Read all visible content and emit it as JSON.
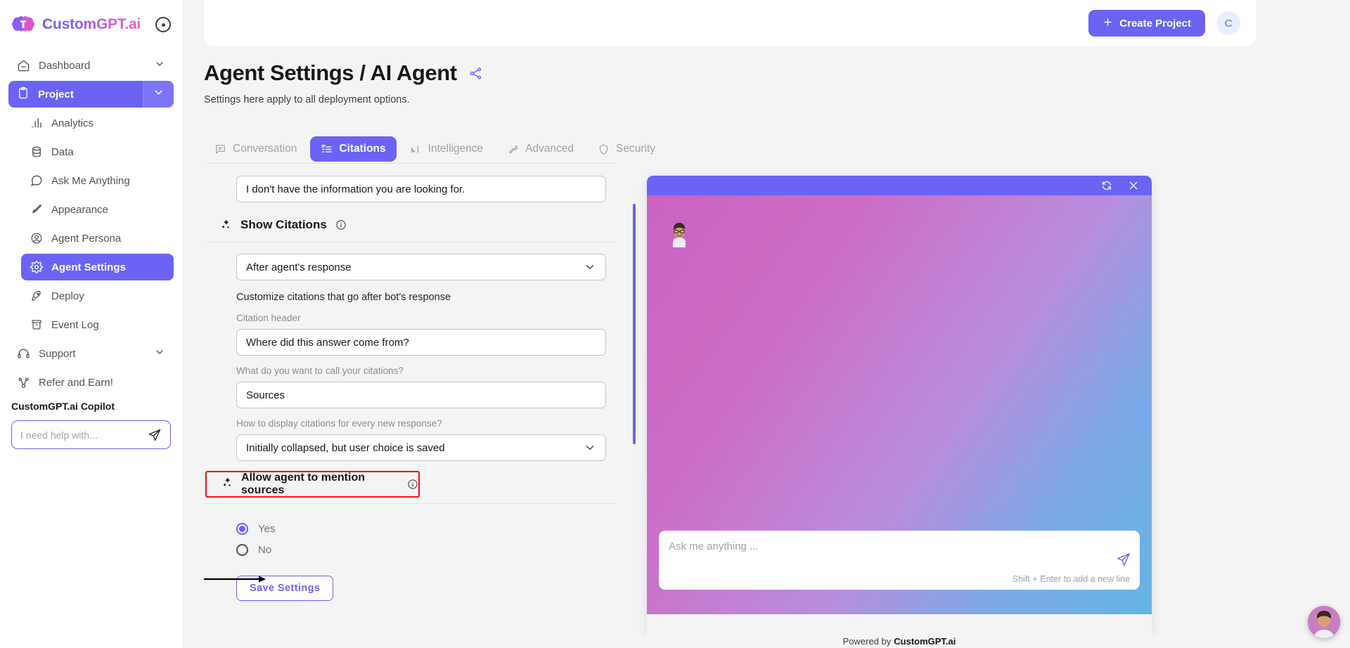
{
  "brand": {
    "name": "CustomGPT.ai",
    "collapse_icon": "collapse-circle-icon"
  },
  "sidebar": {
    "items": [
      {
        "label": "Dashboard",
        "icon": "home-icon",
        "chevron": true,
        "level": "top",
        "state": "default"
      },
      {
        "label": "Project",
        "icon": "clipboard-icon",
        "chevron": true,
        "level": "top",
        "state": "active"
      },
      {
        "label": "Analytics",
        "icon": "bar-chart-icon",
        "level": "sub",
        "state": "default"
      },
      {
        "label": "Data",
        "icon": "database-icon",
        "level": "sub",
        "state": "default"
      },
      {
        "label": "Ask Me Anything",
        "icon": "chat-bubble-icon",
        "level": "sub",
        "state": "default"
      },
      {
        "label": "Appearance",
        "icon": "brush-icon",
        "level": "sub",
        "state": "default"
      },
      {
        "label": "Agent Persona",
        "icon": "user-circle-icon",
        "level": "sub",
        "state": "default"
      },
      {
        "label": "Agent Settings",
        "icon": "gear-icon",
        "level": "sub",
        "state": "active"
      },
      {
        "label": "Deploy",
        "icon": "rocket-icon",
        "level": "sub",
        "state": "default"
      },
      {
        "label": "Event Log",
        "icon": "archive-icon",
        "level": "sub",
        "state": "default"
      },
      {
        "label": "Support",
        "icon": "headset-icon",
        "chevron": true,
        "level": "top",
        "state": "default"
      },
      {
        "label": "Refer and Earn!",
        "icon": "share-nodes-icon",
        "level": "top",
        "state": "default"
      }
    ],
    "copilot": {
      "title": "CustomGPT.ai Copilot",
      "placeholder": "I need help with...",
      "value": "",
      "send_icon": "paper-plane-icon"
    }
  },
  "topbar": {
    "create_label": "Create Project",
    "plus_icon": "plus-icon",
    "avatar_initial": "C"
  },
  "page": {
    "title": "Agent Settings / AI Agent",
    "share_icon": "share-icon",
    "subtitle": "Settings here apply to all deployment options."
  },
  "tabs": [
    {
      "label": "Conversation",
      "icon": "message-square-icon",
      "active": false
    },
    {
      "label": "Citations",
      "icon": "quote-list-icon",
      "active": true
    },
    {
      "label": "Intelligence",
      "icon": "ai-icon",
      "active": false
    },
    {
      "label": "Advanced",
      "icon": "wrench-icon",
      "active": false
    },
    {
      "label": "Security",
      "icon": "shield-icon",
      "active": false
    }
  ],
  "form": {
    "fallback_value": "I don't have the information you are looking for.",
    "show_citations": {
      "heading": "Show Citations",
      "heading_icon": "sparkle-icon",
      "info_icon": "info-icon",
      "select_value": "After agent's response",
      "chevron_icon": "chevron-down-icon",
      "helper": "Customize citations that go after bot's response"
    },
    "citation_header": {
      "label": "Citation header",
      "value": "Where did this answer come from?"
    },
    "citation_name": {
      "label": "What do you want to call your citations?",
      "value": "Sources"
    },
    "citation_display": {
      "label": "How to display citations for every new response?",
      "value": "Initially collapsed, but user choice is saved"
    },
    "mention_sources": {
      "heading": "Allow agent to mention sources",
      "heading_icon": "sparkle-icon",
      "info_icon": "info-icon",
      "highlight_color": "#ee1111",
      "options": [
        {
          "label": "Yes",
          "selected": true
        },
        {
          "label": "No",
          "selected": false
        }
      ]
    },
    "save_label": "Save Settings"
  },
  "widget": {
    "refresh_icon": "refresh-icon",
    "close_icon": "close-icon",
    "avatar_icon": "person-avatar-icon",
    "input_placeholder": "Ask me anything ...",
    "input_value": "",
    "input_hint": "Shift + Enter to add a new line",
    "send_icon": "paper-plane-icon",
    "footer_prefix": "Powered by",
    "footer_brand": "CustomGPT.ai"
  },
  "fab": {
    "icon": "chat-launcher-avatar-icon"
  },
  "colors": {
    "accent": "#6c63f5",
    "accent_light": "#7d75f7",
    "highlight": "#ee1111",
    "page_bg": "#f4f4f5",
    "text": "#18181b",
    "muted": "#a1a1aa"
  }
}
